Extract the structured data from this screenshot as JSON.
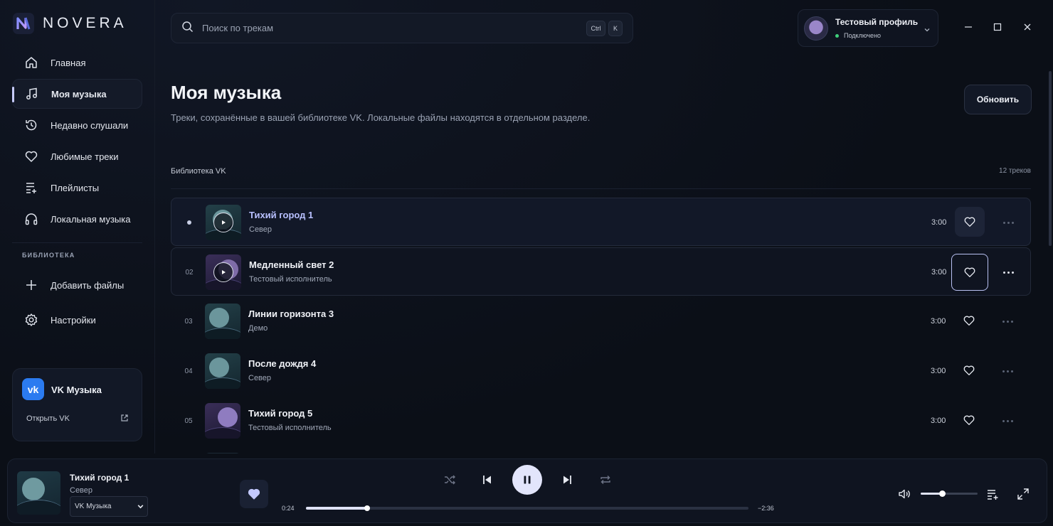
{
  "app": {
    "logo_text": "NOVERA"
  },
  "sidebar": {
    "items": [
      {
        "label": "Главная",
        "icon": "home-icon"
      },
      {
        "label": "Моя музыка",
        "icon": "music-note-icon",
        "active": true
      },
      {
        "label": "Недавно слушали",
        "icon": "history-icon"
      },
      {
        "label": "Любимые треки",
        "icon": "heart-icon"
      },
      {
        "label": "Плейлисты",
        "icon": "playlist-icon"
      },
      {
        "label": "Локальная музыка",
        "icon": "headphones-icon"
      }
    ],
    "section_label": "БИБЛИОТЕКА",
    "library_items": [
      {
        "label": "Добавить файлы",
        "icon": "plus-icon"
      },
      {
        "label": "Настройки",
        "icon": "settings-gear-icon"
      }
    ],
    "vk_card": {
      "logo": "vk",
      "title": "VK Музыка",
      "open_label": "Открыть VK",
      "icon": "external-link-icon"
    }
  },
  "search": {
    "placeholder": "Поиск по трекам",
    "shortcut_1": "Ctrl",
    "shortcut_2": "K"
  },
  "profile": {
    "name": "Тестовый профиль",
    "status": "Подключено",
    "status_color": "#3fcf7a"
  },
  "header": {
    "title": "Моя музыка",
    "subtitle": "Треки, сохранённые в вашей библиотеке VK. Локальные файлы находятся в отдельном разделе.",
    "refresh_label": "Обновить"
  },
  "library": {
    "label": "Библиотека VK",
    "count": "12 треков"
  },
  "tracks": [
    {
      "num": "",
      "title": "Тихий город 1",
      "artist": "Север",
      "duration": "3:00",
      "state": "playing"
    },
    {
      "num": "02",
      "title": "Медленный свет 2",
      "artist": "Тестовый исполнитель",
      "duration": "3:00",
      "state": "hover"
    },
    {
      "num": "03",
      "title": "Линии горизонта 3",
      "artist": "Демо",
      "duration": "3:00",
      "state": ""
    },
    {
      "num": "04",
      "title": "После дождя 4",
      "artist": "Север",
      "duration": "3:00",
      "state": ""
    },
    {
      "num": "05",
      "title": "Тихий город 5",
      "artist": "Тестовый исполнитель",
      "duration": "3:00",
      "state": ""
    }
  ],
  "player": {
    "title": "Тихий город 1",
    "artist": "Север",
    "source": "VK Музыка",
    "time_current": "0:24",
    "time_remaining": "−2:36",
    "progress": 0.138,
    "volume": 0.38,
    "accent": "#e2e5fb"
  }
}
